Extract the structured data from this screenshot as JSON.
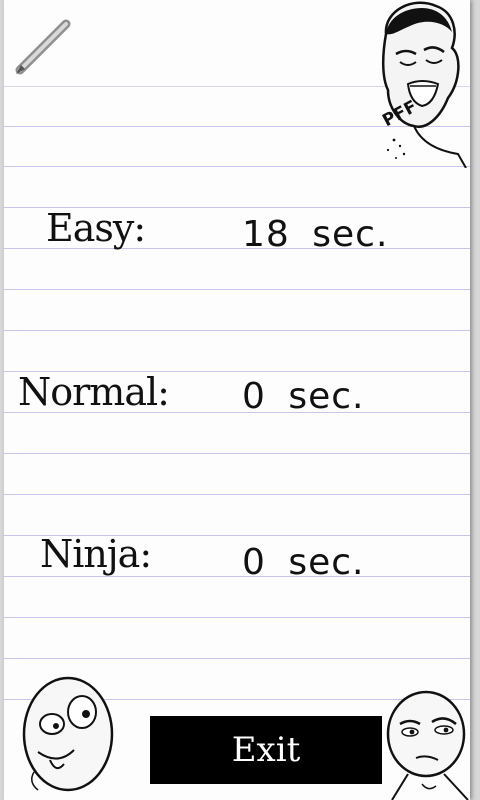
{
  "scores": [
    {
      "label": "Easy:",
      "value": "18 sec."
    },
    {
      "label": "Normal:",
      "value": "0 sec."
    },
    {
      "label": "Ninja:",
      "value": "0 sec."
    }
  ],
  "exit_button": {
    "label": "Exit"
  },
  "meme_face_top": {
    "text": "PFF"
  },
  "colors": {
    "paper": "#fdfdfd",
    "rule_line": "#c9c5ea",
    "button_bg": "#000000",
    "button_text": "#ffffff"
  },
  "icons": [
    "pencil-icon",
    "laughing-meme-face-icon",
    "derp-meme-face-icon",
    "challenge-accepted-face-icon"
  ]
}
